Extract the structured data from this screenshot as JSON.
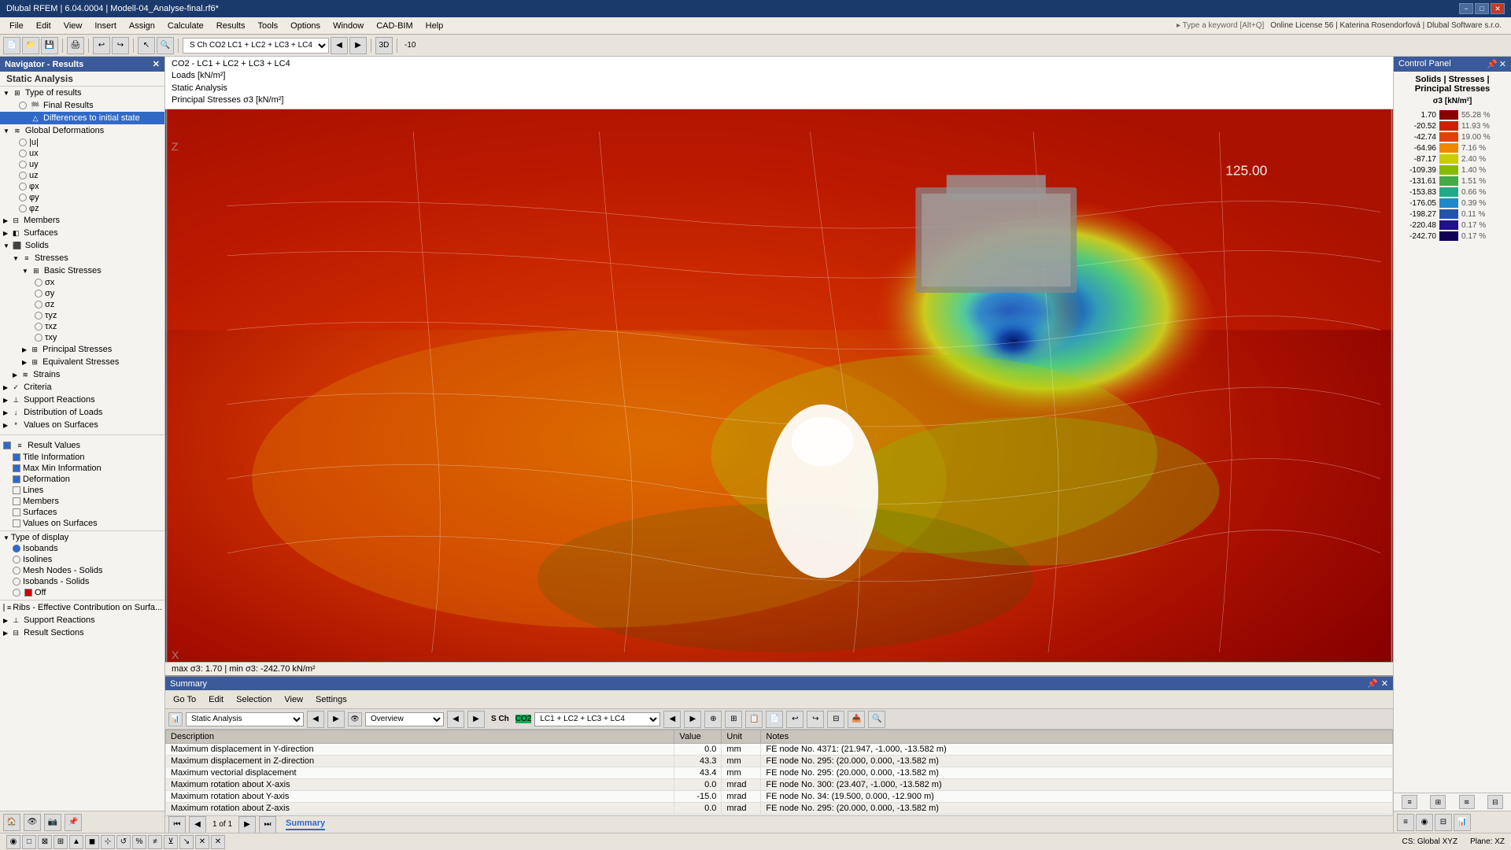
{
  "titlebar": {
    "title": "Dlubal RFEM | 6.04.0004 | Modell-04_Analyse-final.rf6*",
    "minimize": "−",
    "maximize": "□",
    "close": "✕"
  },
  "menubar": {
    "items": [
      "File",
      "Edit",
      "View",
      "Insert",
      "Assign",
      "Calculate",
      "Results",
      "Tools",
      "Options",
      "Window",
      "CAD-BIM",
      "Help"
    ]
  },
  "sidebar": {
    "header": "Navigator - Results",
    "static_analysis_label": "Static Analysis",
    "sections": [
      {
        "label": "Type of results",
        "expanded": true,
        "children": [
          {
            "label": "Final Results",
            "type": "radio",
            "checked": false,
            "indent": 1
          },
          {
            "label": "Differences to initial state",
            "type": "radio",
            "checked": true,
            "indent": 1
          }
        ]
      },
      {
        "label": "Global Deformations",
        "expanded": true,
        "children": [
          {
            "label": "|u|",
            "type": "radio",
            "checked": false,
            "indent": 1
          },
          {
            "label": "ux",
            "type": "radio",
            "checked": false,
            "indent": 1
          },
          {
            "label": "uy",
            "type": "radio",
            "checked": false,
            "indent": 1
          },
          {
            "label": "uz",
            "type": "radio",
            "checked": false,
            "indent": 1
          },
          {
            "label": "φx",
            "type": "radio",
            "checked": false,
            "indent": 1
          },
          {
            "label": "φy",
            "type": "radio",
            "checked": false,
            "indent": 1
          },
          {
            "label": "φz",
            "type": "radio",
            "checked": false,
            "indent": 1
          }
        ]
      },
      {
        "label": "Members",
        "expanded": false,
        "indent": 0
      },
      {
        "label": "Surfaces",
        "expanded": false,
        "indent": 0
      },
      {
        "label": "Solids",
        "expanded": true,
        "children": [
          {
            "label": "Stresses",
            "expanded": true,
            "children": [
              {
                "label": "Basic Stresses",
                "expanded": true,
                "children": [
                  {
                    "label": "σx",
                    "indent": 4
                  },
                  {
                    "label": "σy",
                    "indent": 4
                  },
                  {
                    "label": "σz",
                    "indent": 4
                  },
                  {
                    "label": "τyz",
                    "indent": 4
                  },
                  {
                    "label": "τxz",
                    "indent": 4
                  },
                  {
                    "label": "τxy",
                    "indent": 4
                  }
                ]
              },
              {
                "label": "Principal Stresses",
                "indent": 3
              },
              {
                "label": "Equivalent Stresses",
                "indent": 3
              }
            ]
          },
          {
            "label": "Strains",
            "indent": 2
          }
        ]
      },
      {
        "label": "Criteria",
        "indent": 0
      },
      {
        "label": "Support Reactions",
        "indent": 0
      },
      {
        "label": "Distribution of Loads",
        "indent": 0
      },
      {
        "label": "Values on Surfaces",
        "indent": 0
      }
    ]
  },
  "result_values": {
    "header": "Result Values",
    "items": [
      {
        "label": "Title Information",
        "checked": true
      },
      {
        "label": "Max Min Information",
        "checked": true
      },
      {
        "label": "Deformation",
        "checked": true
      },
      {
        "label": "Lines",
        "checked": false
      },
      {
        "label": "Members",
        "checked": false
      },
      {
        "label": "Surfaces",
        "checked": false
      },
      {
        "label": "Values on Surfaces",
        "checked": false
      }
    ]
  },
  "type_of_display": {
    "label": "Type of display",
    "items": [
      {
        "label": "Isobands",
        "checked": true
      },
      {
        "label": "Isolines",
        "checked": false
      },
      {
        "label": "Mesh Nodes - Solids",
        "checked": false
      },
      {
        "label": "Isobands - Solids",
        "checked": false
      },
      {
        "label": "Off",
        "checked": false
      }
    ]
  },
  "other_nav": [
    {
      "label": "Ribs - Effective Contribution on Surfa...",
      "checked": true
    },
    {
      "label": "Support Reactions"
    },
    {
      "label": "Result Sections"
    }
  ],
  "info_bar": {
    "line1": "CO2 - LC1 + LC2 + LC3 + LC4",
    "line2": "Loads [kN/m²]",
    "line3": "Static Analysis",
    "line4": "Principal Stresses σ3 [kN/m²]"
  },
  "viewport_status": {
    "text": "max σ3: 1.70 | min σ3: -242.70 kN/m²"
  },
  "legend": {
    "header": "Control Panel",
    "subtitle": "Solids | Stresses | Principal Stresses",
    "unit": "σ3 [kN/m²]",
    "items": [
      {
        "value": "1.70",
        "color": "#8b0000",
        "pct": "55.28 %"
      },
      {
        "value": "-20.52",
        "color": "#cc2200",
        "pct": "11.93 %"
      },
      {
        "value": "-42.74",
        "color": "#dd4400",
        "pct": "19.00 %"
      },
      {
        "value": "-64.96",
        "color": "#ee8800",
        "pct": "7.16 %"
      },
      {
        "value": "-87.17",
        "color": "#cccc00",
        "pct": "2.40 %"
      },
      {
        "value": "-109.39",
        "color": "#88bb00",
        "pct": "1.40 %"
      },
      {
        "value": "-131.61",
        "color": "#44aa44",
        "pct": "1.51 %"
      },
      {
        "value": "-153.83",
        "color": "#22aa88",
        "pct": "0.66 %"
      },
      {
        "value": "-176.05",
        "color": "#2288cc",
        "pct": "0.39 %"
      },
      {
        "value": "-198.27",
        "color": "#2255aa",
        "pct": "0.11 %"
      },
      {
        "value": "-220.48",
        "color": "#221188",
        "pct": "0.17 %"
      },
      {
        "value": "-242.70",
        "color": "#110055",
        "pct": "0.17 %"
      }
    ]
  },
  "summary": {
    "header": "Summary",
    "menu_items": [
      "Go To",
      "Edit",
      "Selection",
      "View",
      "Settings"
    ],
    "combo_analysis": "Static Analysis",
    "combo_view": "Overview",
    "combo_lc": "LC1 + LC2 + LC3 + LC4",
    "columns": [
      "Description",
      "Value",
      "Unit",
      "Notes"
    ],
    "rows": [
      {
        "description": "Maximum displacement in Y-direction",
        "value": "0.0",
        "unit": "mm",
        "notes": "FE node No. 4371: (21.947, -1.000, -13.582 m)"
      },
      {
        "description": "Maximum displacement in Z-direction",
        "value": "43.3",
        "unit": "mm",
        "notes": "FE node No. 295: (20.000, 0.000, -13.582 m)"
      },
      {
        "description": "Maximum vectorial displacement",
        "value": "43.4",
        "unit": "mm",
        "notes": "FE node No. 295: (20.000, 0.000, -13.582 m)"
      },
      {
        "description": "Maximum rotation about X-axis",
        "value": "0.0",
        "unit": "mrad",
        "notes": "FE node No. 300: (23.407, -1.000, -13.582 m)"
      },
      {
        "description": "Maximum rotation about Y-axis",
        "value": "-15.0",
        "unit": "mrad",
        "notes": "FE node No. 34: (19.500, 0.000, -12.900 m)"
      },
      {
        "description": "Maximum rotation about Z-axis",
        "value": "0.0",
        "unit": "mrad",
        "notes": "FE node No. 295: (20.000, 0.000, -13.582 m)"
      }
    ],
    "nav": {
      "first": "⏮",
      "prev": "◀",
      "page": "1 of 1",
      "next": "▶",
      "last": "⏭",
      "tab": "Summary"
    }
  },
  "status_bar": {
    "cs": "CS: Global XYZ",
    "plane": "Plane: XZ"
  }
}
